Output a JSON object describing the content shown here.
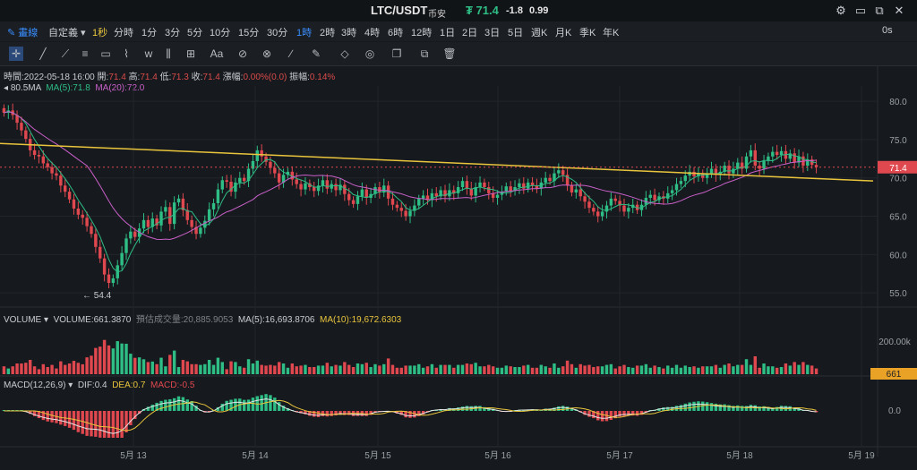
{
  "header": {
    "pair": "LTC/USDT",
    "exchange": "币安",
    "price": "₮ 71.4",
    "change": "-1.8",
    "change_pct": "0.99",
    "accent": "#2ebd85"
  },
  "window_controls": [
    "settings-icon",
    "restore-icon",
    "maximize-icon",
    "close-icon"
  ],
  "toolbar": {
    "draw_label": "畫線",
    "custom_label": "自定義",
    "intervals": [
      "1秒",
      "分時",
      "1分",
      "3分",
      "5分",
      "10分",
      "15分",
      "30分",
      "1時",
      "2時",
      "3時",
      "4時",
      "6時",
      "12時",
      "1日",
      "2日",
      "3日",
      "5日",
      "週K",
      "月K",
      "季K",
      "年K"
    ],
    "active_interval": "1時",
    "countdown": "0s"
  },
  "ohlc": {
    "time_label": "時間:",
    "time": "2022-05-18 16:00",
    "open_label": "開:",
    "open": "71.4",
    "high_label": "高:",
    "high": "71.4",
    "low_label": "低:",
    "low": "71.3",
    "close_label": "收:",
    "close": "71.4",
    "change_label": "漲幅:",
    "change": "0.00%(0.0)",
    "amp_label": "振幅:",
    "amp": "0.14%"
  },
  "ma": {
    "prefix": "80.5MA",
    "ma5": "MA(5):71.8",
    "ma20": "MA(20):72.0",
    "ma5_color": "#2ebd85",
    "ma20_color": "#c85fc8"
  },
  "price_axis": {
    "ticks": [
      "80.0",
      "75.0",
      "70.0",
      "65.0",
      "60.0",
      "55.0"
    ],
    "current": "71.4",
    "low_mark": "54.4"
  },
  "volume": {
    "title": "VOLUME",
    "volume": "VOLUME:661.3870",
    "est": "預估成交量:20,885.9053",
    "ma5": "MA(5):16,693.8706",
    "ma10": "MA(10):19,672.6303",
    "tick": "200.00k",
    "current": "661"
  },
  "macd": {
    "title": "MACD(12,26,9)",
    "dif": "DIF:0.4",
    "dea": "DEA:0.7",
    "macd": "MACD:-0.5",
    "tick": "0.0"
  },
  "dates": [
    "5月 13",
    "5月 14",
    "5月 15",
    "5月 16",
    "5月 17",
    "5月 18",
    "5月 19"
  ],
  "colors": {
    "up": "#2ebd85",
    "down": "#e0484f",
    "trend": "#e9c43c"
  },
  "chart_data": {
    "type": "candlestick",
    "closes": [
      78.5,
      78.8,
      78.2,
      77.2,
      76.2,
      75.1,
      73.6,
      73.0,
      72.8,
      71.9,
      71.4,
      70.6,
      70.3,
      69.0,
      68.2,
      67.2,
      66.0,
      65.2,
      64.8,
      63.7,
      62.7,
      61.0,
      59.5,
      57.4,
      56.3,
      56.9,
      58.6,
      60.2,
      62.1,
      63.0,
      62.3,
      63.4,
      64.5,
      63.6,
      64.7,
      63.8,
      65.6,
      66.2,
      64.0,
      66.8,
      67.3,
      65.8,
      64.5,
      63.6,
      62.7,
      63.5,
      64.4,
      65.9,
      66.7,
      68.5,
      69.7,
      69.5,
      68.2,
      69.4,
      70.0,
      69.6,
      71.2,
      72.2,
      73.6,
      72.8,
      72.1,
      71.3,
      70.6,
      69.4,
      70.4,
      70.8,
      69.8,
      69.2,
      68.5,
      69.3,
      68.8,
      68.3,
      69.0,
      69.7,
      68.6,
      69.2,
      68.4,
      69.1,
      67.9,
      67.1,
      66.6,
      67.6,
      68.5,
      67.4,
      67.9,
      68.8,
      68.1,
      69.0,
      67.3,
      66.5,
      66.1,
      65.7,
      65.0,
      65.7,
      66.4,
      67.3,
      67.7,
      67.1,
      68.0,
      67.6,
      68.4,
      67.6,
      68.4,
      68.0,
      68.8,
      69.6,
      68.6,
      67.7,
      68.8,
      69.4,
      68.8,
      68.0,
      67.4,
      67.8,
      68.2,
      68.9,
      68.3,
      68.8,
      69.3,
      68.6,
      69.4,
      69.0,
      68.6,
      69.4,
      70.0,
      69.6,
      70.6,
      71.0,
      70.4,
      69.0,
      68.1,
      68.5,
      67.6,
      66.9,
      66.1,
      65.6,
      65.0,
      65.6,
      66.4,
      67.3,
      67.0,
      66.4,
      65.6,
      66.1,
      66.5,
      65.8,
      66.5,
      67.4,
      67.8,
      67.1,
      67.6,
      67.3,
      68.0,
      68.4,
      69.2,
      69.6,
      70.3,
      70.8,
      70.2,
      70.6,
      70.0,
      70.6,
      71.2,
      70.4,
      70.8,
      71.6,
      70.6,
      71.2,
      72.0,
      71.2,
      72.8,
      73.6,
      71.6,
      71.2,
      72.2,
      72.8,
      73.4,
      73.0,
      73.5,
      72.5,
      73.2,
      72.0,
      72.8,
      71.6,
      72.4,
      71.7,
      71.4
    ],
    "trend_line": {
      "start": 74.5,
      "end": 69.6
    },
    "ylim": [
      53.5,
      82.0
    ]
  }
}
